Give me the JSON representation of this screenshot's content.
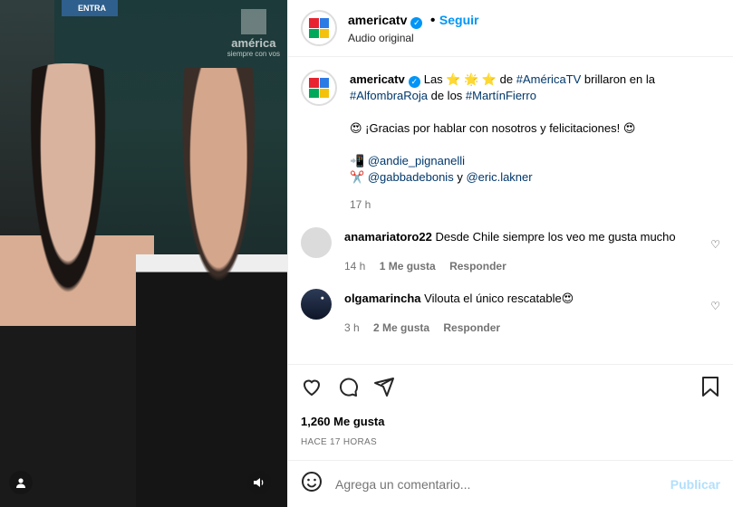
{
  "media": {
    "sign_text": "ENTRA",
    "watermark_brand": "américa",
    "watermark_tag": "siempre con vos",
    "user_icon": "user-icon",
    "audio_icon": "speaker-icon"
  },
  "header": {
    "username": "americatv",
    "follow_label": "Seguir",
    "subtitle": "Audio original"
  },
  "caption": {
    "username": "americatv",
    "line1_pre": "Las ⭐ 🌟 ⭐ de ",
    "hashtag1": "#AméricaTV",
    "line1_post": " brillaron en la",
    "hashtag2": "#AlfombraRoja",
    "line2_mid": " de los ",
    "hashtag3": "#MartínFierro",
    "thanks": "😍 ¡Gracias por hablar con nosotros y felicitaciones! 😍",
    "credit1_icon": "📲",
    "credit1": "@andie_pignanelli",
    "credit2_icon": "✂️",
    "credit2a": "@gabbadebonis",
    "credit2_and": " y ",
    "credit2b": "@eric.lakner",
    "time": "17 h"
  },
  "comments": [
    {
      "username": "anamariatoro22",
      "text": "Desde Chile siempre los veo me gusta mucho",
      "time": "14 h",
      "likes": "1 Me gusta",
      "reply": "Responder"
    },
    {
      "username": "olgamarincha",
      "text": "Vilouta el único rescatable😍",
      "time": "3 h",
      "likes": "2 Me gusta",
      "reply": "Responder"
    }
  ],
  "actions": {
    "like_icon": "heart-icon",
    "comment_icon": "comment-icon",
    "share_icon": "share-icon",
    "save_icon": "bookmark-icon"
  },
  "likes_count": "1,260 Me gusta",
  "time_ago": "HACE 17 HORAS",
  "add_comment": {
    "placeholder": "Agrega un comentario...",
    "publish_label": "Publicar"
  },
  "colors": {
    "link": "#00376b",
    "accent": "#0095f6",
    "publish_disabled": "#b2dffc"
  }
}
